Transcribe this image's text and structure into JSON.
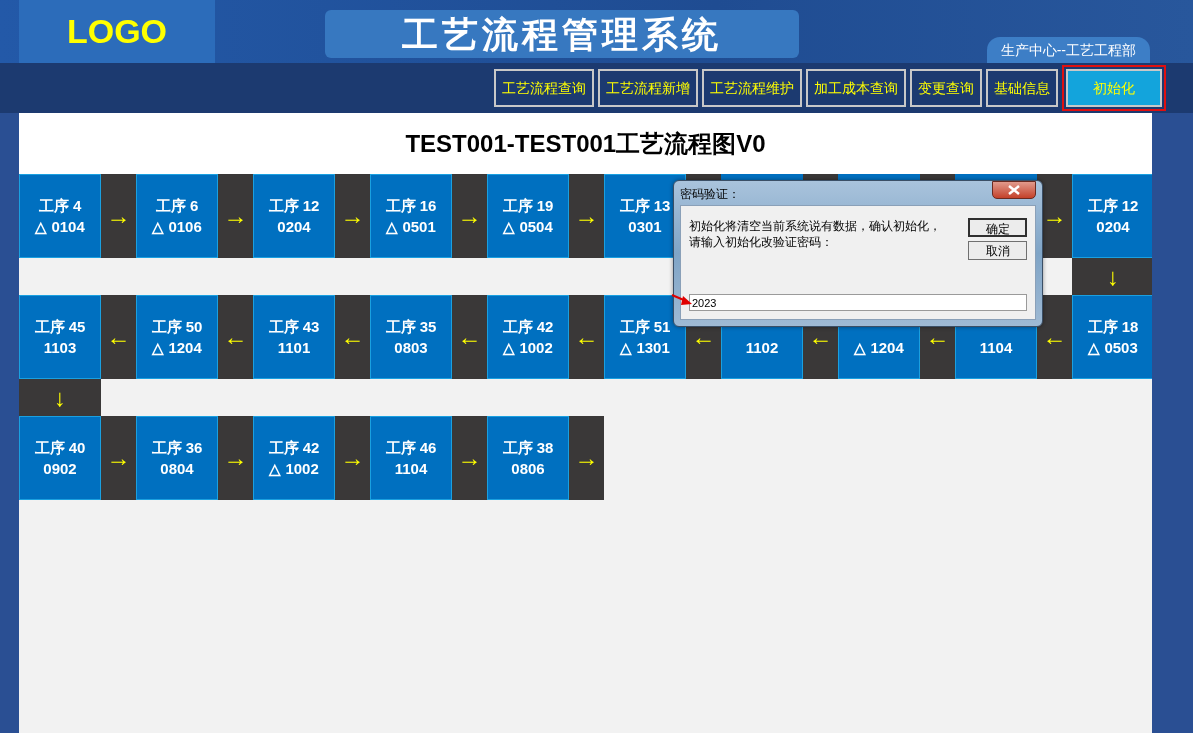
{
  "header": {
    "logo": "LOGO",
    "title": "工艺流程管理系统",
    "department": "生产中心--工艺工程部"
  },
  "nav": [
    {
      "label": "工艺流程查询",
      "selected": false
    },
    {
      "label": "工艺流程新增",
      "selected": false
    },
    {
      "label": "工艺流程维护",
      "selected": false
    },
    {
      "label": "加工成本查询",
      "selected": false
    },
    {
      "label": "变更查询",
      "selected": false
    },
    {
      "label": "基础信息",
      "selected": false
    },
    {
      "label": "初始化",
      "selected": true
    }
  ],
  "chart_title": "TEST001-TEST001工艺流程图V0",
  "flow": [
    {
      "kind": "steps",
      "steps": [
        {
          "title": "工序 4",
          "code": "△ 0104",
          "arrow": "→"
        },
        {
          "title": "工序 6",
          "code": "△ 0106",
          "arrow": "→"
        },
        {
          "title": "工序 12",
          "code": "0204",
          "arrow": "→"
        },
        {
          "title": "工序 16",
          "code": "△ 0501",
          "arrow": "→"
        },
        {
          "title": "工序 19",
          "code": "△ 0504",
          "arrow": "→"
        },
        {
          "title": "工序 13",
          "code": "0301"
        },
        {
          "kind": "covered"
        },
        {
          "kind": "covered"
        },
        {
          "kind": "covered",
          "arrow": "→"
        },
        {
          "title": "工序 12",
          "code": "0204"
        }
      ]
    },
    {
      "kind": "turn",
      "arrow": "↓"
    },
    {
      "kind": "steps",
      "steps": [
        {
          "title": "工序 45",
          "code": "1103",
          "arrow": "←"
        },
        {
          "title": "工序 50",
          "code": "△ 1204",
          "arrow": "←"
        },
        {
          "title": "工序 43",
          "code": "1101",
          "arrow": "←"
        },
        {
          "title": "工序 35",
          "code": "0803",
          "arrow": "←"
        },
        {
          "title": "工序 42",
          "code": "△ 1002",
          "arrow": "←"
        },
        {
          "title": "工序 51",
          "code": "△ 1301",
          "arrow": "←"
        },
        {
          "code": "1102",
          "arrow": "←"
        },
        {
          "code": "△ 1204",
          "arrow": "←"
        },
        {
          "code": "1104",
          "arrow": "←"
        },
        {
          "title": "工序 18",
          "code": "△ 0503"
        }
      ]
    },
    {
      "kind": "turn",
      "arrow": "↓"
    },
    {
      "kind": "steps",
      "steps": [
        {
          "title": "工序 40",
          "code": "0902",
          "arrow": "→"
        },
        {
          "title": "工序 36",
          "code": "0804",
          "arrow": "→"
        },
        {
          "title": "工序 42",
          "code": "△ 1002",
          "arrow": "→"
        },
        {
          "title": "工序 46",
          "code": "1104",
          "arrow": "→"
        },
        {
          "title": "工序 38",
          "code": "0806",
          "arrow": "→"
        }
      ]
    }
  ],
  "dialog": {
    "title": "密码验证：",
    "message": "初始化将清空当前系统说有数据，确认初始化，请输入初始化改验证密码：",
    "buttons": [
      "确定",
      "取消"
    ],
    "value": "2023"
  }
}
